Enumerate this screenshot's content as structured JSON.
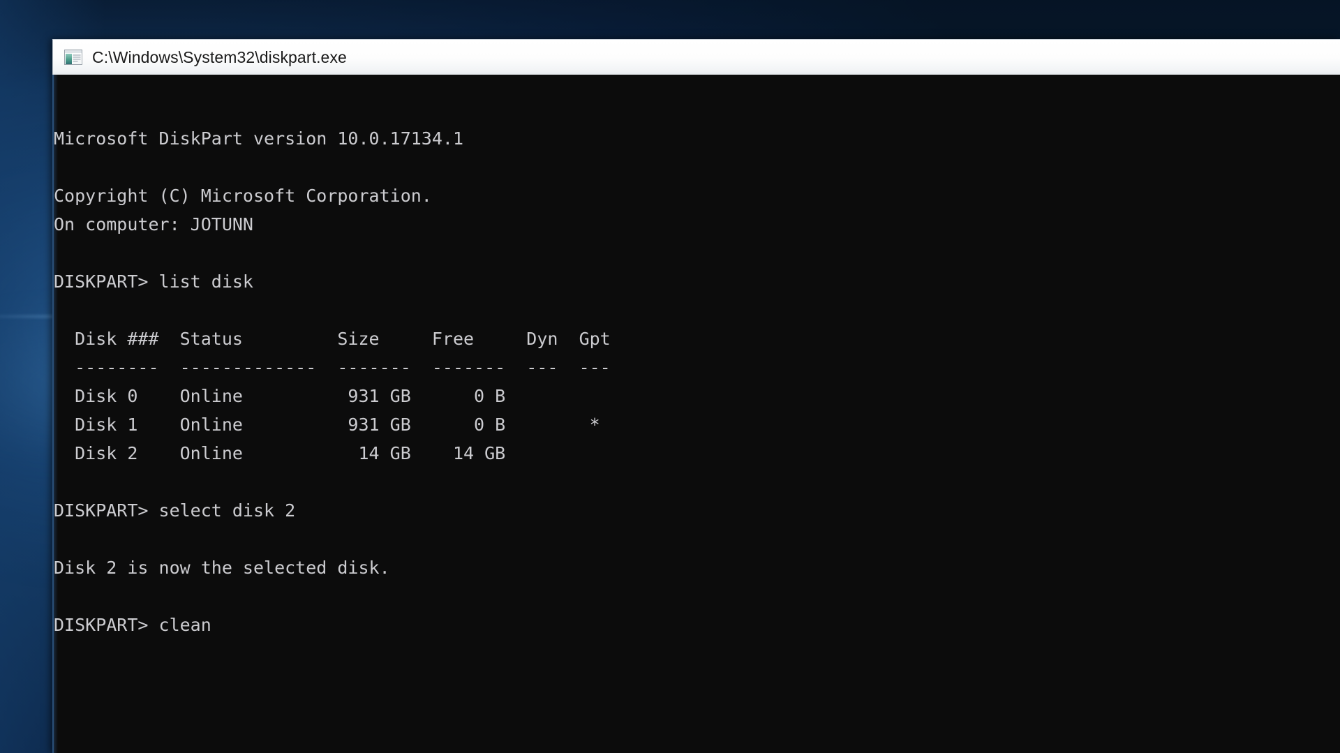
{
  "window": {
    "title": "C:\\Windows\\System32\\diskpart.exe",
    "icon": "console-window-icon",
    "titlebar_bg": "#ffffff",
    "console_bg": "#0c0c0c",
    "console_fg": "#ccccd0",
    "border_color": "#2a4f78"
  },
  "desktop": {
    "background_color": "#0d2b4d"
  },
  "console": {
    "prompt": "DISKPART>",
    "lines": [
      "",
      "Microsoft DiskPart version 10.0.17134.1",
      "",
      "Copyright (C) Microsoft Corporation.",
      "On computer: JOTUNN",
      "",
      "DISKPART> list disk",
      "",
      "  Disk ###  Status         Size     Free     Dyn  Gpt",
      "  --------  -------------  -------  -------  ---  ---",
      "  Disk 0    Online          931 GB      0 B",
      "  Disk 1    Online          931 GB      0 B        *",
      "  Disk 2    Online           14 GB    14 GB",
      "",
      "DISKPART> select disk 2",
      "",
      "Disk 2 is now the selected disk.",
      "",
      "DISKPART> clean"
    ],
    "commands_entered": [
      "list disk",
      "select disk 2",
      "clean"
    ],
    "version_banner": {
      "product": "Microsoft DiskPart",
      "version": "10.0.17134.1",
      "copyright": "Copyright (C) Microsoft Corporation.",
      "computer_label": "On computer:",
      "computer_name": "JOTUNN"
    },
    "disk_table": {
      "columns": [
        "Disk ###",
        "Status",
        "Size",
        "Free",
        "Dyn",
        "Gpt"
      ],
      "separators": [
        "--------",
        "-------------",
        "-------",
        "-------",
        "---",
        "---"
      ],
      "rows": [
        {
          "disk": "Disk 0",
          "status": "Online",
          "size": "931 GB",
          "free": "0 B",
          "dyn": "",
          "gpt": ""
        },
        {
          "disk": "Disk 1",
          "status": "Online",
          "size": "931 GB",
          "free": "0 B",
          "dyn": "",
          "gpt": "*"
        },
        {
          "disk": "Disk 2",
          "status": "Online",
          "size": "14 GB",
          "free": "14 GB",
          "dyn": "",
          "gpt": ""
        }
      ]
    },
    "messages": [
      "Disk 2 is now the selected disk."
    ]
  }
}
